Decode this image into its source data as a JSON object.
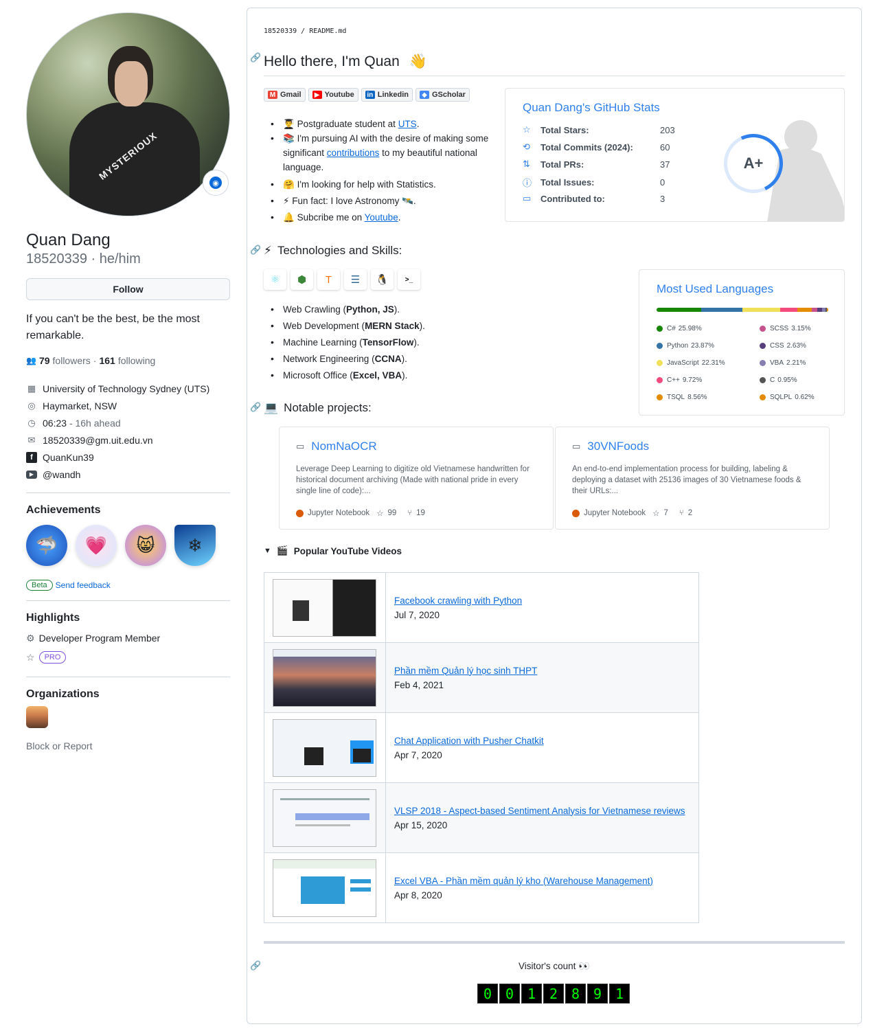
{
  "profile": {
    "shirt_text": "MYSTERIOUX",
    "name": "Quan Dang",
    "login_pronouns": "18520339 · he/him",
    "follow_label": "Follow",
    "bio": "If you can't be the best, be the most remarkable.",
    "followers_count": "79",
    "followers_label": "followers",
    "following_count": "161",
    "following_label": "following",
    "details": {
      "org": "University of Technology Sydney (UTS)",
      "location": "Haymarket, NSW",
      "time": "06:23",
      "time_note": "- 16h ahead",
      "email": "18520339@gm.uit.edu.vn",
      "facebook": "QuanKun39",
      "youtube": "@wandh"
    }
  },
  "achievements": {
    "heading": "Achievements",
    "beta_label": "Beta",
    "feedback_label": "Send feedback",
    "items": [
      "shark-badge",
      "heart-badge",
      "cat-badge",
      "arctic-badge"
    ]
  },
  "highlights": {
    "heading": "Highlights",
    "developer_program": "Developer Program Member",
    "pro_label": "PRO"
  },
  "organizations": {
    "heading": "Organizations",
    "block_label": "Block or Report"
  },
  "readme": {
    "breadcrumb": "18520339 / README.md",
    "greeting": "Hello there, I'm Quan",
    "greeting_emoji": "👋",
    "shields": [
      {
        "label": "Gmail",
        "icon": "gmail-icon",
        "color": "#ea4335",
        "glyph": "M"
      },
      {
        "label": "Youtube",
        "icon": "youtube-icon",
        "color": "#ff0000",
        "glyph": "▶"
      },
      {
        "label": "Linkedin",
        "icon": "linkedin-icon",
        "color": "#0a66c2",
        "glyph": "in"
      },
      {
        "label": "GScholar",
        "icon": "gscholar-icon",
        "color": "#4285f4",
        "glyph": "◆"
      }
    ],
    "about": {
      "l1_emoji": "👨‍🎓",
      "l1_pre": "Postgraduate student at ",
      "l1_link": "UTS",
      "l1_post": ".",
      "l2_emoji": "📚",
      "l2_pre": "I'm pursuing AI with the desire of making some significant ",
      "l2_link": "contributions",
      "l2_post": " to my beautiful national language.",
      "l3_emoji": "🤗",
      "l3_text": "I'm looking for help with Statistics.",
      "l4_emoji": "⚡",
      "l4_text": "Fun fact: I love Astronomy 🛰️.",
      "l5_emoji": "🔔",
      "l5_pre": "Subcribe me on ",
      "l5_link": "Youtube",
      "l5_post": "."
    },
    "tech_heading": "Technologies and Skills:",
    "tech_emoji": "⚡",
    "tech_icons": [
      {
        "name": "react-icon",
        "glyph": "⚛",
        "color": "#61dafb"
      },
      {
        "name": "nodejs-icon",
        "glyph": "⬢",
        "color": "#3c873a"
      },
      {
        "name": "tensorflow-icon",
        "glyph": "T",
        "color": "#ff6f00"
      },
      {
        "name": "database-icon",
        "glyph": "☰",
        "color": "#336791"
      },
      {
        "name": "linux-icon",
        "glyph": "🐧",
        "color": "#000000"
      },
      {
        "name": "terminal-icon",
        "glyph": ">_",
        "color": "#000000"
      }
    ],
    "skills": [
      {
        "pre": "Web Crawling (",
        "bold": "Python, JS",
        "post": ")."
      },
      {
        "pre": "Web Development (",
        "bold": "MERN Stack",
        "post": ")."
      },
      {
        "pre": "Machine Learning (",
        "bold": "TensorFlow",
        "post": ")."
      },
      {
        "pre": "Network Engineering (",
        "bold": "CCNA",
        "post": ")."
      },
      {
        "pre": "Microsoft Office (",
        "bold": "Excel, VBA",
        "post": ")."
      }
    ],
    "projects_heading": "Notable projects:",
    "projects_emoji": "💻",
    "stats": {
      "title": "Quan Dang's GitHub Stats",
      "rows": [
        {
          "icon": "star-icon",
          "glyph": "☆",
          "label": "Total Stars:",
          "value": "203"
        },
        {
          "icon": "history-icon",
          "glyph": "⟲",
          "label": "Total Commits (2024):",
          "value": "60"
        },
        {
          "icon": "pull-request-icon",
          "glyph": "⇅",
          "label": "Total PRs:",
          "value": "37"
        },
        {
          "icon": "issue-icon",
          "glyph": "ⓘ",
          "label": "Total Issues:",
          "value": "0"
        },
        {
          "icon": "repo-icon",
          "glyph": "▭",
          "label": "Contributed to:",
          "value": "3"
        }
      ],
      "rank": "A+",
      "rank_progress": 0.62
    },
    "languages": {
      "title": "Most Used Languages",
      "items": [
        {
          "name": "C#",
          "percent": "25.98%",
          "value": 25.98,
          "color": "#178600"
        },
        {
          "name": "SCSS",
          "percent": "3.15%",
          "value": 3.15,
          "color": "#c6538c"
        },
        {
          "name": "Python",
          "percent": "23.87%",
          "value": 23.87,
          "color": "#3572a5"
        },
        {
          "name": "CSS",
          "percent": "2.63%",
          "value": 2.63,
          "color": "#563d7c"
        },
        {
          "name": "JavaScript",
          "percent": "22.31%",
          "value": 22.31,
          "color": "#f1e05a"
        },
        {
          "name": "VBA",
          "percent": "2.21%",
          "value": 2.21,
          "color": "#867db1"
        },
        {
          "name": "C++",
          "percent": "9.72%",
          "value": 9.72,
          "color": "#f34b7d"
        },
        {
          "name": "C",
          "percent": "0.95%",
          "value": 0.95,
          "color": "#555555"
        },
        {
          "name": "TSQL",
          "percent": "8.56%",
          "value": 8.56,
          "color": "#e38c00"
        },
        {
          "name": "SQLPL",
          "percent": "0.62%",
          "value": 0.62,
          "color": "#e38c00"
        }
      ]
    },
    "projects": [
      {
        "title": "NomNaOCR",
        "desc": "Leverage Deep Learning to digitize old Vietnamese handwritten for historical document archiving (Made with national pride in every single line of code):...",
        "lang": "Jupyter Notebook",
        "stars": "99",
        "forks": "19"
      },
      {
        "title": "30VNFoods",
        "desc": "An end-to-end implementation process for building, labeling & deploying a dataset with 25136 images of 30 Vietnamese foods & their URLs:...",
        "lang": "Jupyter Notebook",
        "stars": "7",
        "forks": "2"
      }
    ],
    "videos_summary": "Popular YouTube Videos",
    "videos_emoji": "🎬",
    "videos": [
      {
        "title": "Facebook crawling with Python",
        "date": "Jul 7, 2020"
      },
      {
        "title": "Phần mềm Quản lý học sinh THPT",
        "date": "Feb 4, 2021"
      },
      {
        "title": "Chat Application with Pusher Chatkit",
        "date": "Apr 7, 2020"
      },
      {
        "title": "VLSP 2018 - Aspect-based Sentiment Analysis for Vietnamese reviews",
        "date": "Apr 15, 2020"
      },
      {
        "title": "Excel VBA - Phần mềm quản lý kho (Warehouse Management)",
        "date": "Apr 8, 2020"
      }
    ],
    "visitor_label": "Visitor's count 👀",
    "visitor_digits": [
      "0",
      "0",
      "1",
      "2",
      "8",
      "9",
      "1"
    ]
  }
}
